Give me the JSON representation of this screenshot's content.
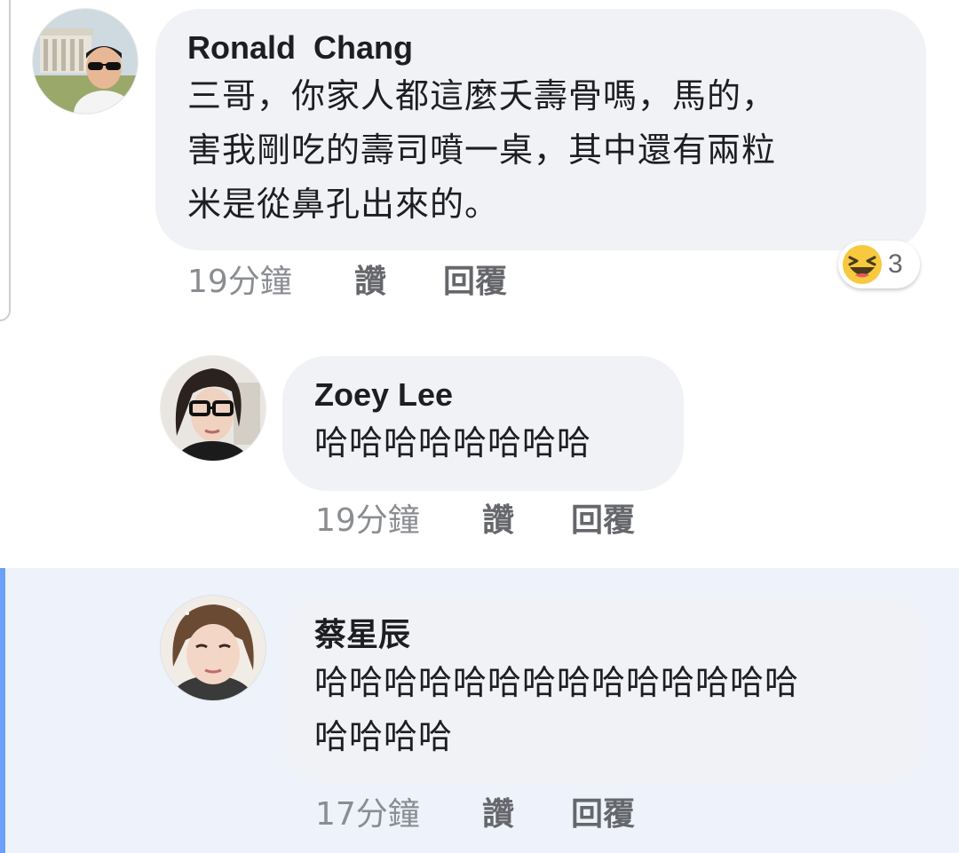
{
  "comments": [
    {
      "author": "Ronald  Chang",
      "lines": [
        "三哥，你家人都這麼夭壽骨嗎，馬的，",
        "害我剛吃的壽司噴一桌，其中還有兩粒",
        "米是從鼻孔出來的。"
      ],
      "time": "19分鐘",
      "like_label": "讚",
      "reply_label": "回覆",
      "reaction": {
        "icon": "laughing-emoji-icon",
        "count": "3"
      }
    },
    {
      "author": "Zoey Lee",
      "lines": [
        "哈哈哈哈哈哈哈哈"
      ],
      "time": "19分鐘",
      "like_label": "讚",
      "reply_label": "回覆"
    },
    {
      "author": "蔡星辰",
      "lines": [
        "哈哈哈哈哈哈哈哈哈哈哈哈哈哈",
        "哈哈哈哈"
      ],
      "time": "17分鐘",
      "like_label": "讚",
      "reply_label": "回覆"
    }
  ],
  "colors": {
    "bubble": "#f0f2f5",
    "highlight": "#eef3fb",
    "highlight_bar": "#6aa0f7",
    "meta_text": "#8a8d91"
  }
}
